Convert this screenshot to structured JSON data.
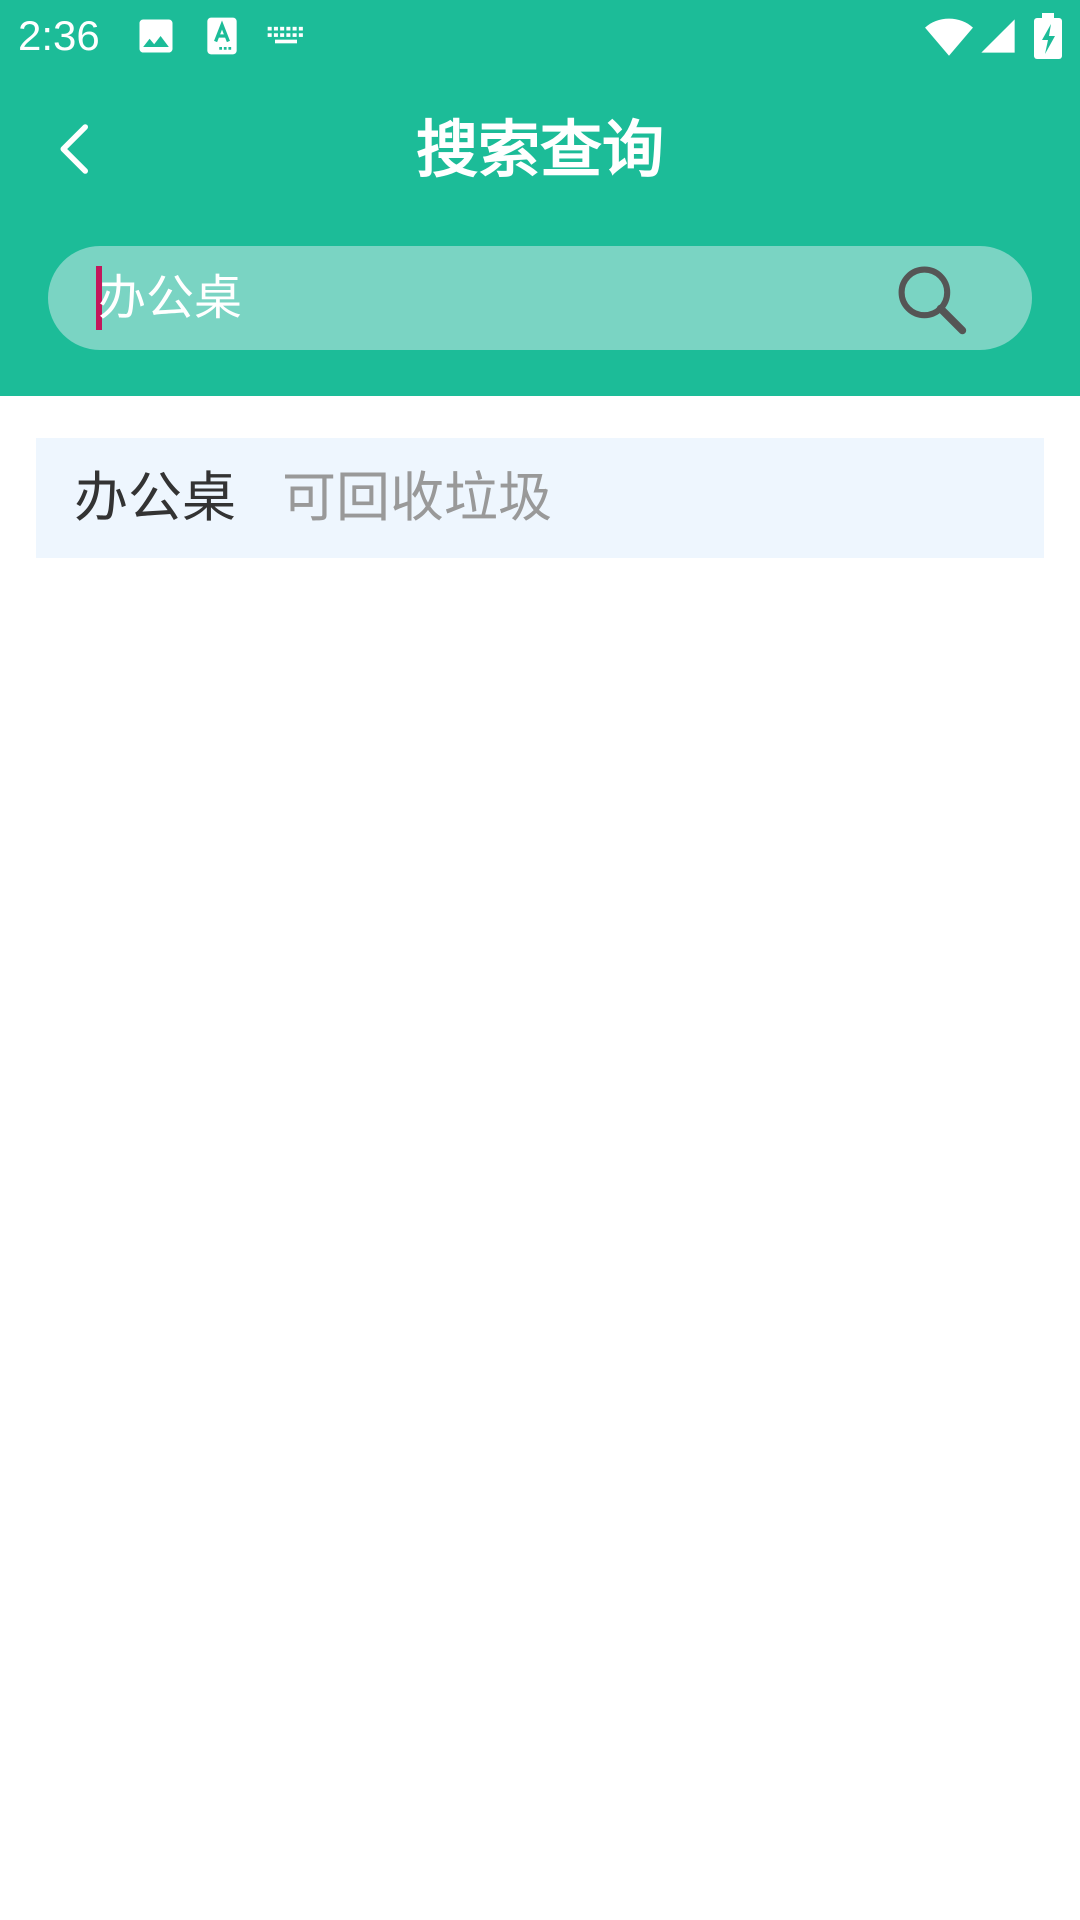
{
  "status_bar": {
    "time": "2:36",
    "notification_icons": [
      "image-icon",
      "text-recognition-icon",
      "keyboard-icon"
    ],
    "system_icons": [
      "wifi-icon",
      "cellular-signal-icon",
      "battery-charging-icon"
    ]
  },
  "app_bar": {
    "title": "搜索查询",
    "back_icon": "chevron-left-icon"
  },
  "search": {
    "value": "办公桌",
    "button_icon": "search-icon"
  },
  "results": [
    {
      "name": "办公桌",
      "category": "可回收垃圾"
    }
  ],
  "colors": {
    "header": "#1CBC98",
    "search_field": "#7AD4C3",
    "cursor": "#C2185B",
    "result_background": "#EEF6FE",
    "result_name": "#333333",
    "result_category": "#999999",
    "search_icon": "#555555"
  }
}
